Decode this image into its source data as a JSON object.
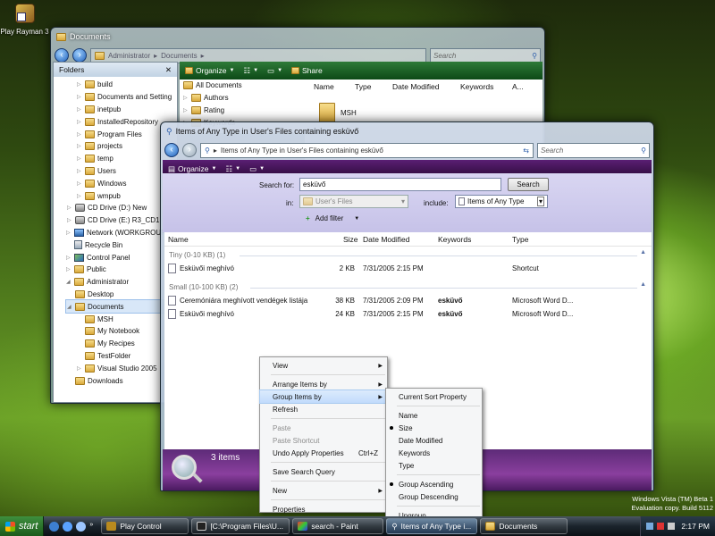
{
  "desktop": {
    "icon_label": "Play Rayman 3",
    "watermark": [
      "Windows Vista (TM) Beta 1",
      "Evaluation copy. Build 5112"
    ]
  },
  "back_window": {
    "title": "Documents",
    "breadcrumb": [
      "Administrator",
      "Documents"
    ],
    "search_placeholder": "Search",
    "toolbar": {
      "organize": "Organize",
      "share": "Share"
    },
    "folders_header": "Folders",
    "folders": [
      "build",
      "Documents and Setting",
      "inetpub",
      "InstalledRepository",
      "Program Files",
      "projects",
      "temp",
      "Users",
      "Windows",
      "wmpub",
      "CD Drive (D:) New",
      "CD Drive (E:) R3_CD1",
      "Network (WORKGROUP)",
      "Recycle Bin",
      "Control Panel",
      "Public",
      "Administrator",
      "Desktop",
      "Documents",
      "MSH",
      "My Notebook",
      "My Recipes",
      "TestFolder",
      "Visual Studio 2005",
      "Downloads"
    ],
    "nav_pane": [
      "All Documents",
      "Authors",
      "Rating",
      "Keywords"
    ],
    "columns": [
      "Name",
      "Type",
      "Date Modified",
      "Keywords",
      "A..."
    ],
    "folder_item": "MSH"
  },
  "front_window": {
    "title": "Items of Any Type in User's Files containing esküvő",
    "address": "Items of Any Type in User's Files containing esküvő",
    "search_placeholder": "Search",
    "toolbar": {
      "organize": "Organize"
    },
    "search_for_label": "Search for:",
    "search_for_value": "esküvő",
    "search_button": "Search",
    "in_label": "in:",
    "in_value": "User's Files",
    "include_label": "include:",
    "include_value": "Items of Any Type",
    "add_filter": "Add filter",
    "columns": [
      "Name",
      "Size",
      "Date Modified",
      "Keywords",
      "Type"
    ],
    "groups": [
      {
        "header": "Tiny (0-10 KB) (1)",
        "files": [
          {
            "name": "Esküvői meghívó",
            "size": "2 KB",
            "date": "7/31/2005 2:15 PM",
            "keywords": "",
            "type": "Shortcut"
          }
        ]
      },
      {
        "header": "Small (10-100 KB) (2)",
        "files": [
          {
            "name": "Ceremóniára meghívott vendégek listája",
            "size": "38 KB",
            "date": "7/31/2005 2:09 PM",
            "keywords": "esküvő",
            "type": "Microsoft Word D..."
          },
          {
            "name": "Esküvői meghívó",
            "size": "24 KB",
            "date": "7/31/2005 2:15 PM",
            "keywords": "esküvő",
            "type": "Microsoft Word D..."
          }
        ]
      }
    ],
    "status": "3 items"
  },
  "context_menu": {
    "view": "View",
    "arrange": "Arrange Items by",
    "group": "Group Items by",
    "refresh": "Refresh",
    "paste": "Paste",
    "paste_shortcut": "Paste Shortcut",
    "undo": "Undo Apply Properties",
    "undo_shortcut": "Ctrl+Z",
    "save_search": "Save Search Query",
    "new": "New",
    "properties": "Properties"
  },
  "submenu": {
    "current_sort": "Current Sort Property",
    "name": "Name",
    "size": "Size",
    "date": "Date Modified",
    "keywords": "Keywords",
    "type": "Type",
    "asc": "Group Ascending",
    "desc": "Group Descending",
    "ungroup": "Ungroup"
  },
  "taskbar": {
    "start": "start",
    "tasks": [
      "Play Control",
      "[C:\\Program Files\\U...",
      "search - Paint",
      "Items of Any Type i...",
      "Documents"
    ],
    "time": "2:17 PM"
  }
}
